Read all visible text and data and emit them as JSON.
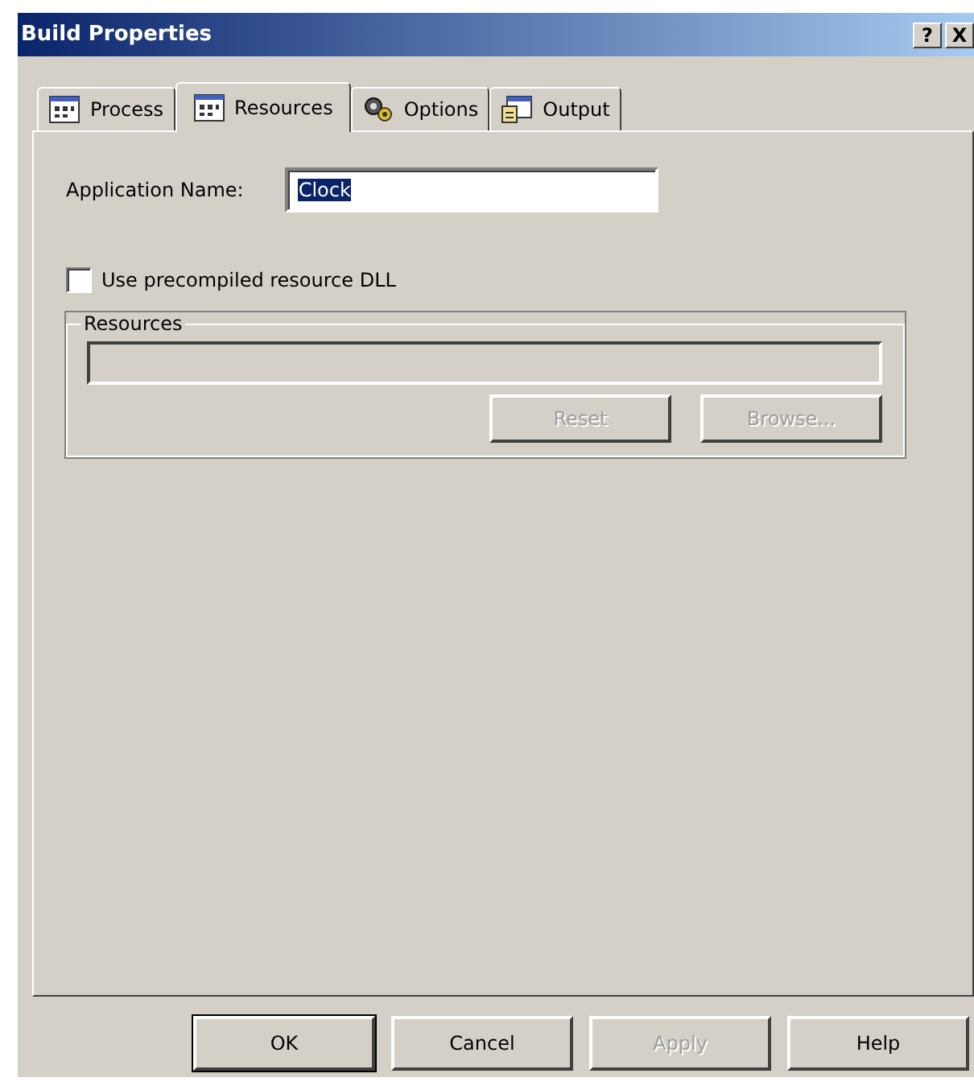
{
  "window": {
    "title": "Build Properties",
    "title_buttons": [
      "?",
      "X"
    ]
  },
  "tabs": [
    {
      "label": "Process",
      "selected": false,
      "kind": "grid"
    },
    {
      "label": "Resources",
      "selected": true,
      "kind": "grid"
    },
    {
      "label": "Options",
      "selected": false,
      "kind": "gears"
    },
    {
      "label": "Output",
      "selected": false,
      "kind": "doc"
    }
  ],
  "application_name": {
    "label": "Application Name:",
    "value": "Clock"
  },
  "precompiled": {
    "label": "Use precompiled resource DLL",
    "checked": false
  },
  "resources_group": {
    "title": "Resources",
    "buttons": [
      {
        "label": "Reset",
        "disabled": true
      },
      {
        "label": "Browse...",
        "disabled": true
      }
    ]
  },
  "buttons": [
    {
      "label": "OK",
      "disabled": false,
      "default": true
    },
    {
      "label": "Cancel",
      "disabled": false,
      "default": false
    },
    {
      "label": "Apply",
      "disabled": true,
      "default": false
    },
    {
      "label": "Help",
      "disabled": false,
      "default": false
    }
  ]
}
